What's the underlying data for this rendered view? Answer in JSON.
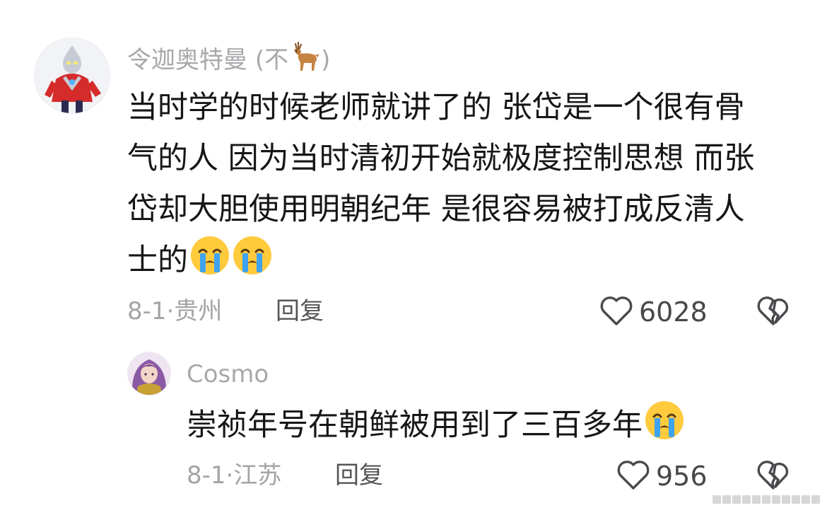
{
  "comments": [
    {
      "username": "令迦奥特曼",
      "username_paren_open": "(不",
      "username_paren_close": ")",
      "username_emoji": "deer-emoji",
      "text_lines": [
        "当时学的时候老师就讲了的  张岱是一个很有骨",
        "气的人  因为当时清初开始就极度控制思想  而张",
        "岱却大胆使用明朝纪年  是很容易被打成反清人",
        "士的"
      ],
      "text_emojis": [
        "crying-face-emoji",
        "crying-face-emoji"
      ],
      "date": "8-1·",
      "location": "贵州",
      "reply_label": "回复",
      "likes": "6028"
    },
    {
      "username": "Cosmo",
      "text": "崇祯年号在朝鲜被用到了三百多年",
      "text_emojis": [
        "crying-face-emoji"
      ],
      "date": "8-1·",
      "location": "江苏",
      "reply_label": "回复",
      "likes": "956"
    }
  ],
  "colors": {
    "username": "#a8a8ac",
    "body": "#161616",
    "meta": "#a4a4a8",
    "icon": "#4a4a4e",
    "emoji_face": "#ffcb3d",
    "emoji_tear": "#3fa2f0"
  }
}
